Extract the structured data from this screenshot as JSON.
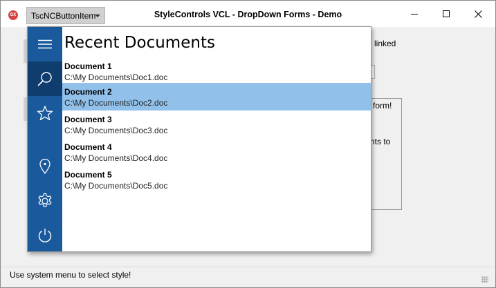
{
  "window": {
    "title": "StyleControls VCL - DropDown Forms - Demo",
    "app_icon_text": "DX"
  },
  "nc_button": {
    "label": "TscNCButtonItem"
  },
  "background": {
    "text_linked": "linked",
    "text_form": "form!",
    "text_nts_to": "nts to"
  },
  "dropdown": {
    "heading": "Recent Documents",
    "sidebar": [
      {
        "icon": "hamburger-menu-icon"
      },
      {
        "icon": "search-icon",
        "active": true
      },
      {
        "icon": "star-icon"
      },
      {
        "icon": "location-pin-icon"
      },
      {
        "icon": "gear-icon"
      },
      {
        "icon": "power-icon"
      }
    ],
    "documents": [
      {
        "title": "Document 1",
        "path": "C:\\My Documents\\Doc1.doc",
        "selected": false
      },
      {
        "title": "Document 2",
        "path": "C:\\My Documents\\Doc2.doc",
        "selected": true
      },
      {
        "title": "Document 3",
        "path": "C:\\My Documents\\Doc3.doc",
        "selected": false
      },
      {
        "title": "Document 4",
        "path": "C:\\My Documents\\Doc4.doc",
        "selected": false
      },
      {
        "title": "Document 5",
        "path": "C:\\My Documents\\Doc5.doc",
        "selected": false
      }
    ]
  },
  "statusbar": {
    "text": "Use system menu to select style!"
  },
  "colors": {
    "sidebar": "#1a5a9c",
    "sidebar_active": "#0f3d6e",
    "selection": "#91c1ea",
    "app_icon": "#d64541"
  }
}
